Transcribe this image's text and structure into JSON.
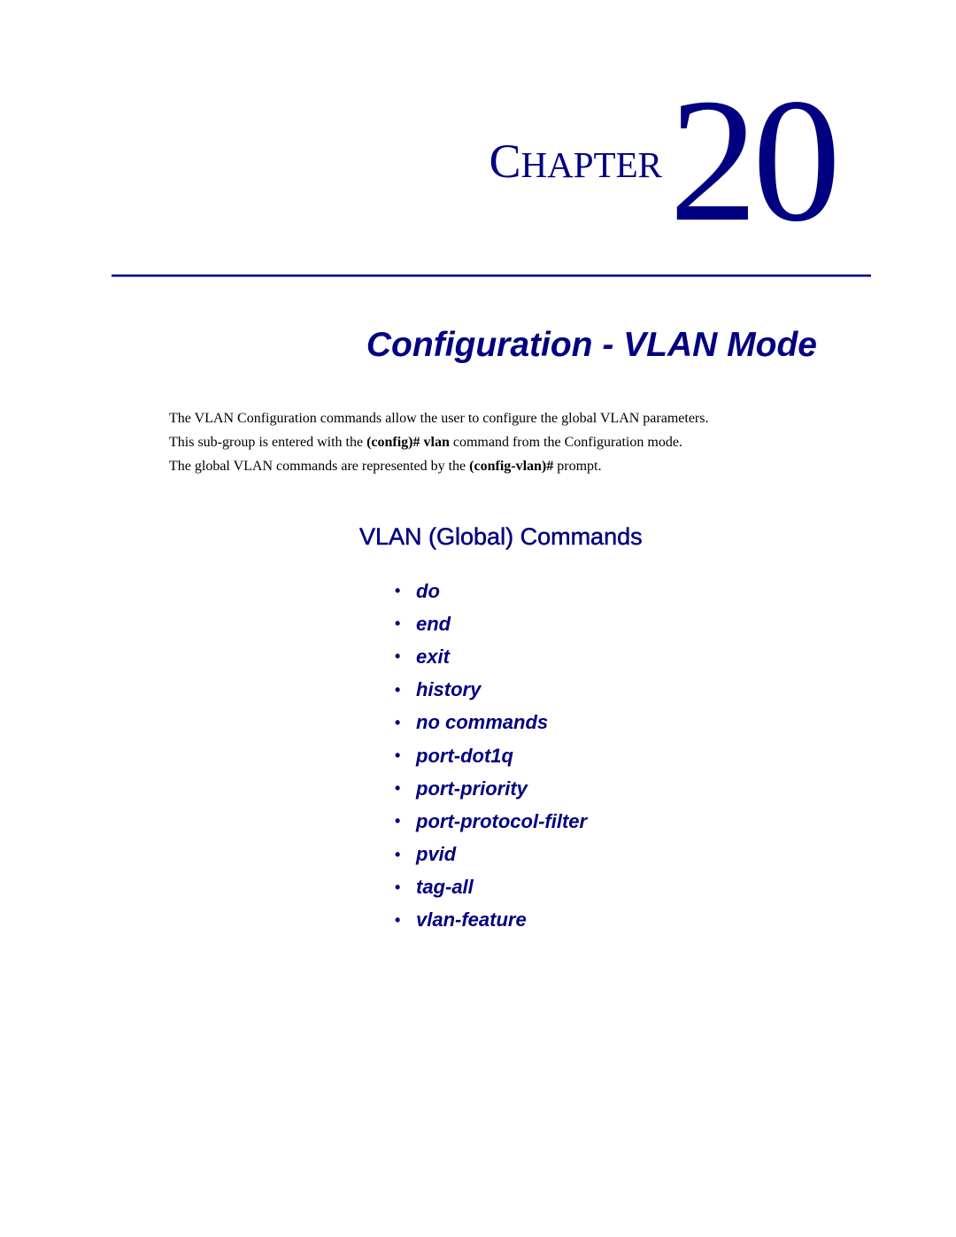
{
  "chapter": {
    "word_first": "C",
    "word_rest": "HAPTER",
    "number": "20"
  },
  "page_title": "Configuration - VLAN Mode",
  "intro": {
    "line1": "The VLAN Configuration commands allow the user to configure the global VLAN parameters.",
    "line2_pre": "This sub-group is entered with the ",
    "line2_bold": "(config)# vlan",
    "line2_post": " command from the Configuration mode.",
    "line3_pre": "The global VLAN commands are represented by the ",
    "line3_bold": "(config-vlan)#",
    "line3_post": " prompt."
  },
  "section_heading": "VLAN (Global) Commands",
  "bullet_glyph": "•",
  "commands": [
    "do",
    "end",
    "exit",
    "history",
    "no commands",
    "port-dot1q",
    "port-priority",
    "port-protocol-filter",
    "pvid",
    "tag-all",
    "vlan-feature"
  ],
  "colors": {
    "heading": "#000080",
    "body_text": "#000000"
  }
}
